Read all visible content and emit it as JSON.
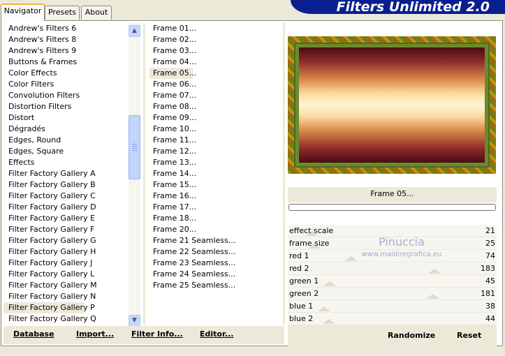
{
  "tabs": [
    "Navigator",
    "Presets",
    "About"
  ],
  "app_title": "Filters Unlimited 2.0",
  "categories": [
    "Andrew's Filters 6",
    "Andrew's Filters 8",
    "Andrew's Filters 9",
    "Buttons & Frames",
    "Color Effects",
    "Color Filters",
    "Convolution Filters",
    "Distortion Filters",
    "Distort",
    "Dégradés",
    "Edges, Round",
    "Edges, Square",
    "Effects",
    "Filter Factory Gallery A",
    "Filter Factory Gallery B",
    "Filter Factory Gallery C",
    "Filter Factory Gallery D",
    "Filter Factory Gallery E",
    "Filter Factory Gallery F",
    "Filter Factory Gallery G",
    "Filter Factory Gallery H",
    "Filter Factory Gallery J",
    "Filter Factory Gallery L",
    "Filter Factory Gallery M",
    "Filter Factory Gallery N",
    "Filter Factory Gallery P",
    "Filter Factory Gallery Q"
  ],
  "selected_category": "Filter Factory Gallery P",
  "filters": [
    "Frame 01...",
    "Frame 02...",
    "Frame 03...",
    "Frame 04...",
    "Frame 05...",
    "Frame 06...",
    "Frame 07...",
    "Frame 08...",
    "Frame 09...",
    "Frame 10...",
    "Frame 11...",
    "Frame 12...",
    "Frame 13...",
    "Frame 14...",
    "Frame 15...",
    "Frame 16...",
    "Frame 17...",
    "Frame 18...",
    "Frame 20...",
    "Frame 21 Seamless...",
    "Frame 22 Seamless...",
    "Frame 23 Seamless...",
    "Frame 24 Seamless...",
    "Frame 25 Seamless..."
  ],
  "selected_filter": "Frame 05...",
  "current_filter_label": "Frame 05...",
  "params": [
    {
      "name": "effect scale",
      "value": "21"
    },
    {
      "name": "frame size",
      "value": "25"
    },
    {
      "name": "red 1",
      "value": "74"
    },
    {
      "name": "red 2",
      "value": "183"
    },
    {
      "name": "green 1",
      "value": "45"
    },
    {
      "name": "green 2",
      "value": "181"
    },
    {
      "name": "blue 1",
      "value": "38"
    },
    {
      "name": "blue 2",
      "value": "44"
    }
  ],
  "buttons": {
    "database": "Database",
    "import": "Import...",
    "filter_info": "Filter Info...",
    "editor": "Editor...",
    "randomize": "Randomize",
    "reset": "Reset"
  },
  "watermark": {
    "name": "Pinuccia",
    "url": "www.maidiregrafica.eu"
  },
  "progress_fraction": 0,
  "colors": {
    "banner": "#0a1f8f",
    "selection": "#ECE9D8",
    "accent": "#f5b33c"
  }
}
